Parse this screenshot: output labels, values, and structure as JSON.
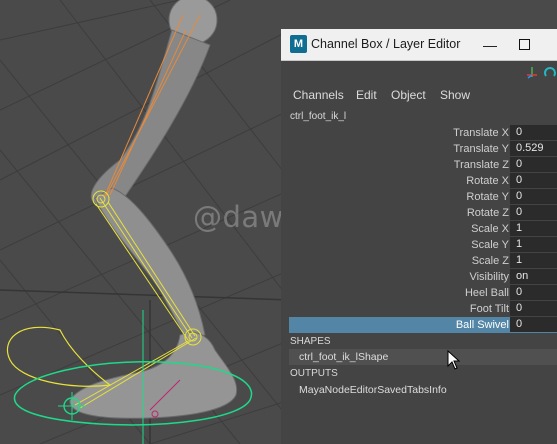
{
  "window": {
    "title": "Channel Box / Layer Editor",
    "app_icon": "M"
  },
  "watermark": "@dawn_arc",
  "menus": [
    "Channels",
    "Edit",
    "Object",
    "Show"
  ],
  "node_name": "ctrl_foot_ik_l",
  "channels": [
    {
      "label": "Translate X",
      "value": "0"
    },
    {
      "label": "Translate Y",
      "value": "0.529"
    },
    {
      "label": "Translate Z",
      "value": "0"
    },
    {
      "label": "Rotate X",
      "value": "0"
    },
    {
      "label": "Rotate Y",
      "value": "0"
    },
    {
      "label": "Rotate Z",
      "value": "0"
    },
    {
      "label": "Scale X",
      "value": "1"
    },
    {
      "label": "Scale Y",
      "value": "1"
    },
    {
      "label": "Scale Z",
      "value": "1"
    },
    {
      "label": "Visibility",
      "value": "on"
    },
    {
      "label": "Heel Ball",
      "value": "0"
    },
    {
      "label": "Foot Tilt",
      "value": "0"
    },
    {
      "label": "Ball Swivel",
      "value": "0",
      "selected": true
    }
  ],
  "shapes": {
    "header": "SHAPES",
    "item": "ctrl_foot_ik_lShape"
  },
  "outputs": {
    "header": "OUTPUTS",
    "item": "MayaNodeEditorSavedTabsInfo"
  },
  "colors": {
    "selection": "#5285a6",
    "panel_bg": "#444444",
    "viewport_bg": "#4a4a4a",
    "bone_yellow": "#e8e23a",
    "bone_orange": "#e58a3c",
    "ctrl_green": "#1fd98a"
  }
}
